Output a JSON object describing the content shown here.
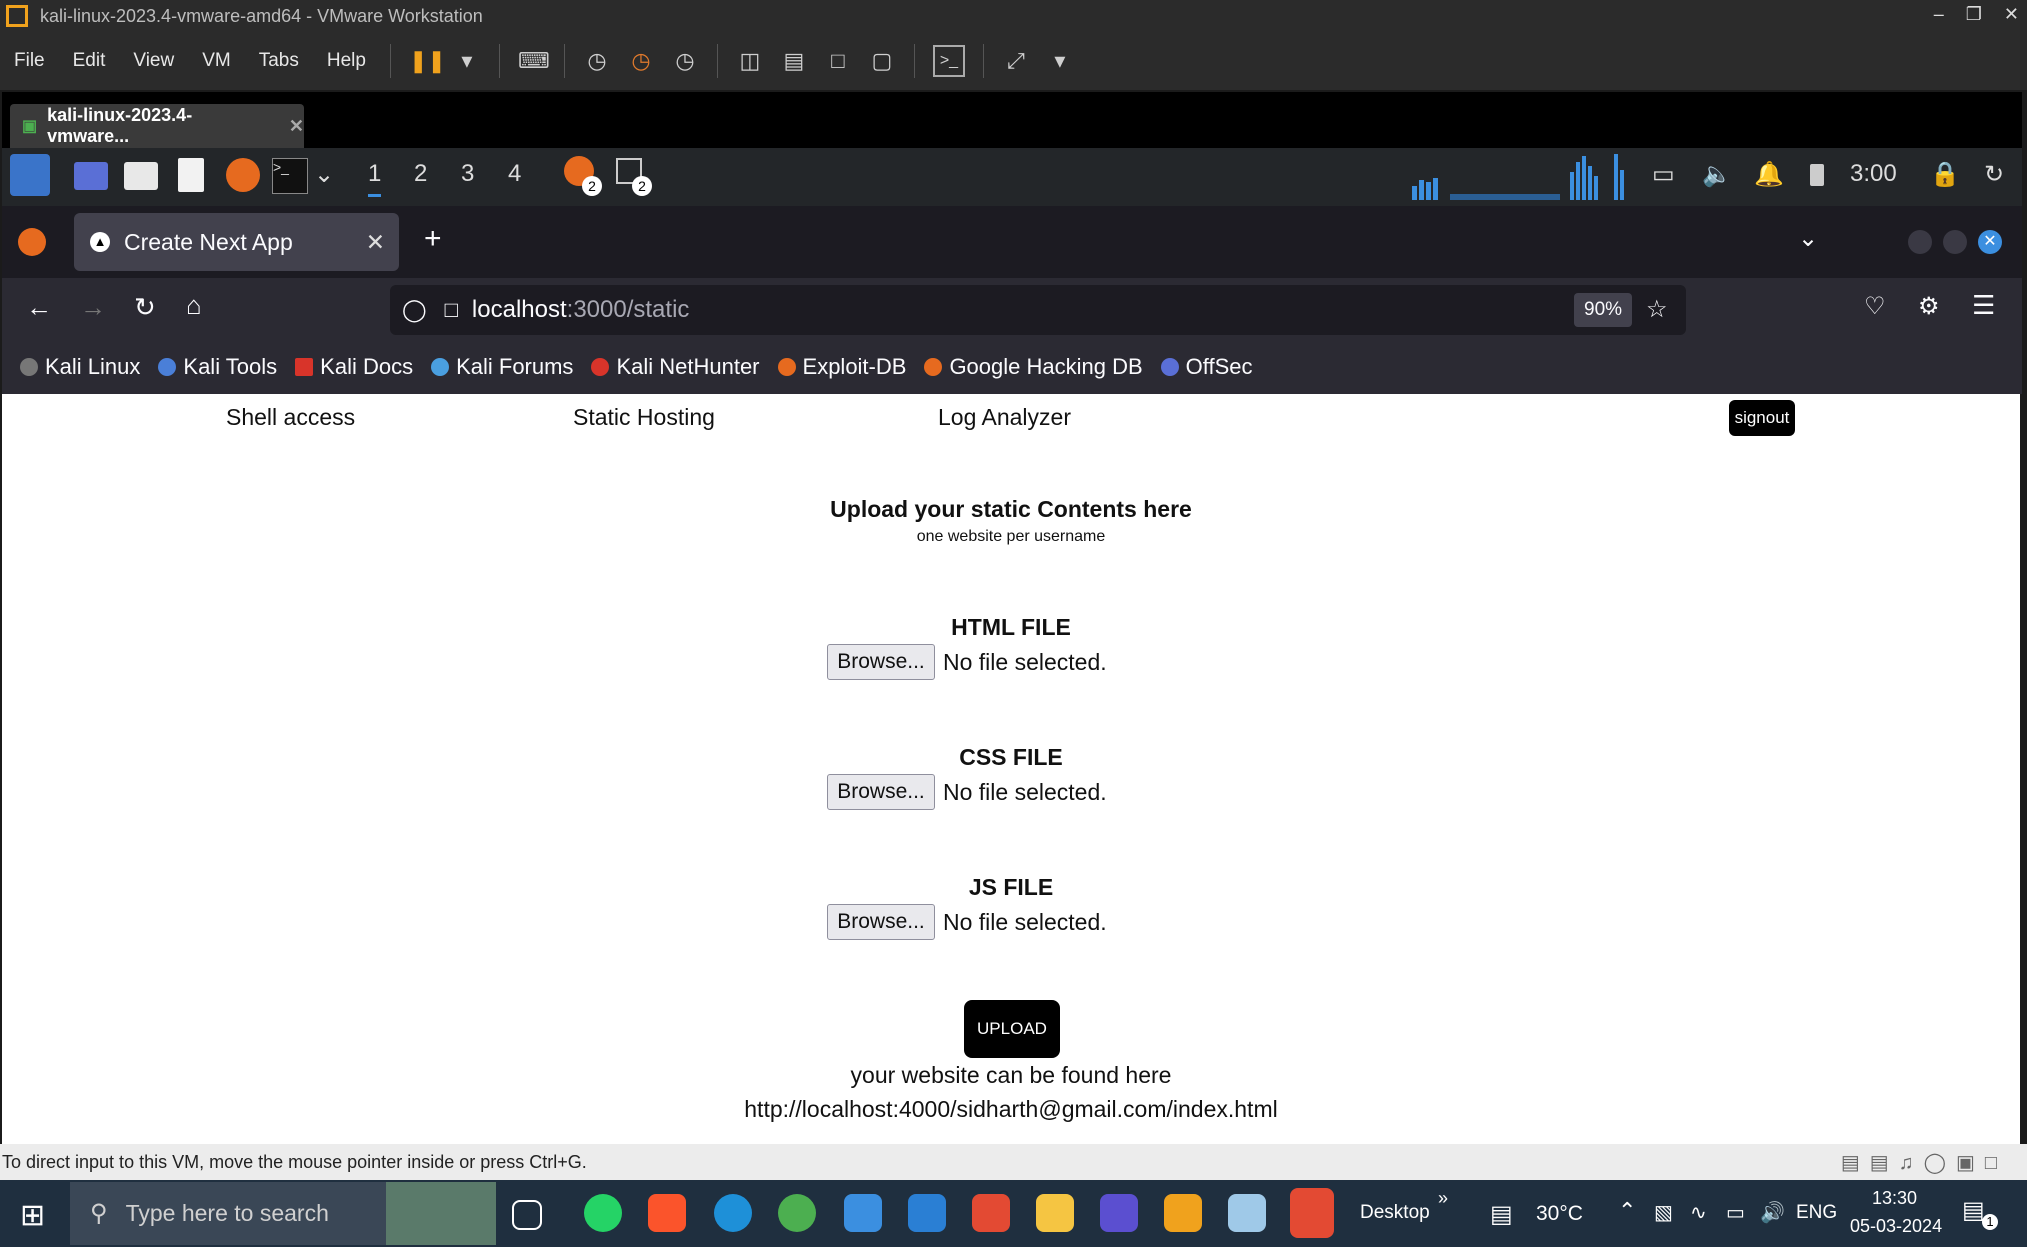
{
  "vmware": {
    "title": "kali-linux-2023.4-vmware-amd64 - VMware Workstation",
    "menu": [
      "File",
      "Edit",
      "View",
      "VM",
      "Tabs",
      "Help"
    ],
    "tab_label": "kali-linux-2023.4-vmware...",
    "status_message": "To direct input to this VM, move the mouse pointer inside or press Ctrl+G."
  },
  "kali_panel": {
    "workspaces": [
      "1",
      "2",
      "3",
      "4"
    ],
    "badge_count": "2",
    "clock": "3:00"
  },
  "browser": {
    "tab_title": "Create Next App",
    "url_host": "localhost",
    "url_path": ":3000/static",
    "zoom": "90%",
    "bookmarks": [
      "Kali Linux",
      "Kali Tools",
      "Kali Docs",
      "Kali Forums",
      "Kali NetHunter",
      "Exploit-DB",
      "Google Hacking DB",
      "OffSec"
    ]
  },
  "page": {
    "nav": [
      "Shell access",
      "Static Hosting",
      "Log Analyzer"
    ],
    "signout_label": "signout",
    "heading": "Upload your static Contents here",
    "subheading": "one website per username",
    "fields": [
      {
        "label": "HTML FILE",
        "button": "Browse...",
        "status": "No file selected."
      },
      {
        "label": "CSS FILE",
        "button": "Browse...",
        "status": "No file selected."
      },
      {
        "label": "JS FILE",
        "button": "Browse...",
        "status": "No file selected."
      }
    ],
    "upload_label": "UPLOAD",
    "result_text": "your website can be found here",
    "result_url": "http://localhost:4000/sidharth@gmail.com/index.html"
  },
  "taskbar": {
    "search_placeholder": "Type here to search",
    "desktop_label": "Desktop",
    "weather": "30°C",
    "language": "ENG",
    "time": "13:30",
    "date": "05-03-2024",
    "notification_count": "1"
  }
}
